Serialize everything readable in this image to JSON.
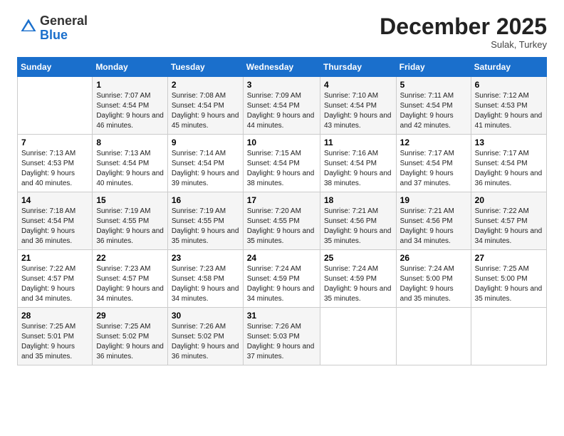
{
  "header": {
    "logo_general": "General",
    "logo_blue": "Blue",
    "title": "December 2025",
    "subtitle": "Sulak, Turkey"
  },
  "columns": [
    "Sunday",
    "Monday",
    "Tuesday",
    "Wednesday",
    "Thursday",
    "Friday",
    "Saturday"
  ],
  "rows": [
    [
      {
        "day": "",
        "info": ""
      },
      {
        "day": "1",
        "info": "Sunrise: 7:07 AM\nSunset: 4:54 PM\nDaylight: 9 hours and 46 minutes."
      },
      {
        "day": "2",
        "info": "Sunrise: 7:08 AM\nSunset: 4:54 PM\nDaylight: 9 hours and 45 minutes."
      },
      {
        "day": "3",
        "info": "Sunrise: 7:09 AM\nSunset: 4:54 PM\nDaylight: 9 hours and 44 minutes."
      },
      {
        "day": "4",
        "info": "Sunrise: 7:10 AM\nSunset: 4:54 PM\nDaylight: 9 hours and 43 minutes."
      },
      {
        "day": "5",
        "info": "Sunrise: 7:11 AM\nSunset: 4:54 PM\nDaylight: 9 hours and 42 minutes."
      },
      {
        "day": "6",
        "info": "Sunrise: 7:12 AM\nSunset: 4:53 PM\nDaylight: 9 hours and 41 minutes."
      }
    ],
    [
      {
        "day": "7",
        "info": "Sunrise: 7:13 AM\nSunset: 4:53 PM\nDaylight: 9 hours and 40 minutes."
      },
      {
        "day": "8",
        "info": "Sunrise: 7:13 AM\nSunset: 4:54 PM\nDaylight: 9 hours and 40 minutes."
      },
      {
        "day": "9",
        "info": "Sunrise: 7:14 AM\nSunset: 4:54 PM\nDaylight: 9 hours and 39 minutes."
      },
      {
        "day": "10",
        "info": "Sunrise: 7:15 AM\nSunset: 4:54 PM\nDaylight: 9 hours and 38 minutes."
      },
      {
        "day": "11",
        "info": "Sunrise: 7:16 AM\nSunset: 4:54 PM\nDaylight: 9 hours and 38 minutes."
      },
      {
        "day": "12",
        "info": "Sunrise: 7:17 AM\nSunset: 4:54 PM\nDaylight: 9 hours and 37 minutes."
      },
      {
        "day": "13",
        "info": "Sunrise: 7:17 AM\nSunset: 4:54 PM\nDaylight: 9 hours and 36 minutes."
      }
    ],
    [
      {
        "day": "14",
        "info": "Sunrise: 7:18 AM\nSunset: 4:54 PM\nDaylight: 9 hours and 36 minutes."
      },
      {
        "day": "15",
        "info": "Sunrise: 7:19 AM\nSunset: 4:55 PM\nDaylight: 9 hours and 36 minutes."
      },
      {
        "day": "16",
        "info": "Sunrise: 7:19 AM\nSunset: 4:55 PM\nDaylight: 9 hours and 35 minutes."
      },
      {
        "day": "17",
        "info": "Sunrise: 7:20 AM\nSunset: 4:55 PM\nDaylight: 9 hours and 35 minutes."
      },
      {
        "day": "18",
        "info": "Sunrise: 7:21 AM\nSunset: 4:56 PM\nDaylight: 9 hours and 35 minutes."
      },
      {
        "day": "19",
        "info": "Sunrise: 7:21 AM\nSunset: 4:56 PM\nDaylight: 9 hours and 34 minutes."
      },
      {
        "day": "20",
        "info": "Sunrise: 7:22 AM\nSunset: 4:57 PM\nDaylight: 9 hours and 34 minutes."
      }
    ],
    [
      {
        "day": "21",
        "info": "Sunrise: 7:22 AM\nSunset: 4:57 PM\nDaylight: 9 hours and 34 minutes."
      },
      {
        "day": "22",
        "info": "Sunrise: 7:23 AM\nSunset: 4:57 PM\nDaylight: 9 hours and 34 minutes."
      },
      {
        "day": "23",
        "info": "Sunrise: 7:23 AM\nSunset: 4:58 PM\nDaylight: 9 hours and 34 minutes."
      },
      {
        "day": "24",
        "info": "Sunrise: 7:24 AM\nSunset: 4:59 PM\nDaylight: 9 hours and 34 minutes."
      },
      {
        "day": "25",
        "info": "Sunrise: 7:24 AM\nSunset: 4:59 PM\nDaylight: 9 hours and 35 minutes."
      },
      {
        "day": "26",
        "info": "Sunrise: 7:24 AM\nSunset: 5:00 PM\nDaylight: 9 hours and 35 minutes."
      },
      {
        "day": "27",
        "info": "Sunrise: 7:25 AM\nSunset: 5:00 PM\nDaylight: 9 hours and 35 minutes."
      }
    ],
    [
      {
        "day": "28",
        "info": "Sunrise: 7:25 AM\nSunset: 5:01 PM\nDaylight: 9 hours and 35 minutes."
      },
      {
        "day": "29",
        "info": "Sunrise: 7:25 AM\nSunset: 5:02 PM\nDaylight: 9 hours and 36 minutes."
      },
      {
        "day": "30",
        "info": "Sunrise: 7:26 AM\nSunset: 5:02 PM\nDaylight: 9 hours and 36 minutes."
      },
      {
        "day": "31",
        "info": "Sunrise: 7:26 AM\nSunset: 5:03 PM\nDaylight: 9 hours and 37 minutes."
      },
      {
        "day": "",
        "info": ""
      },
      {
        "day": "",
        "info": ""
      },
      {
        "day": "",
        "info": ""
      }
    ]
  ]
}
